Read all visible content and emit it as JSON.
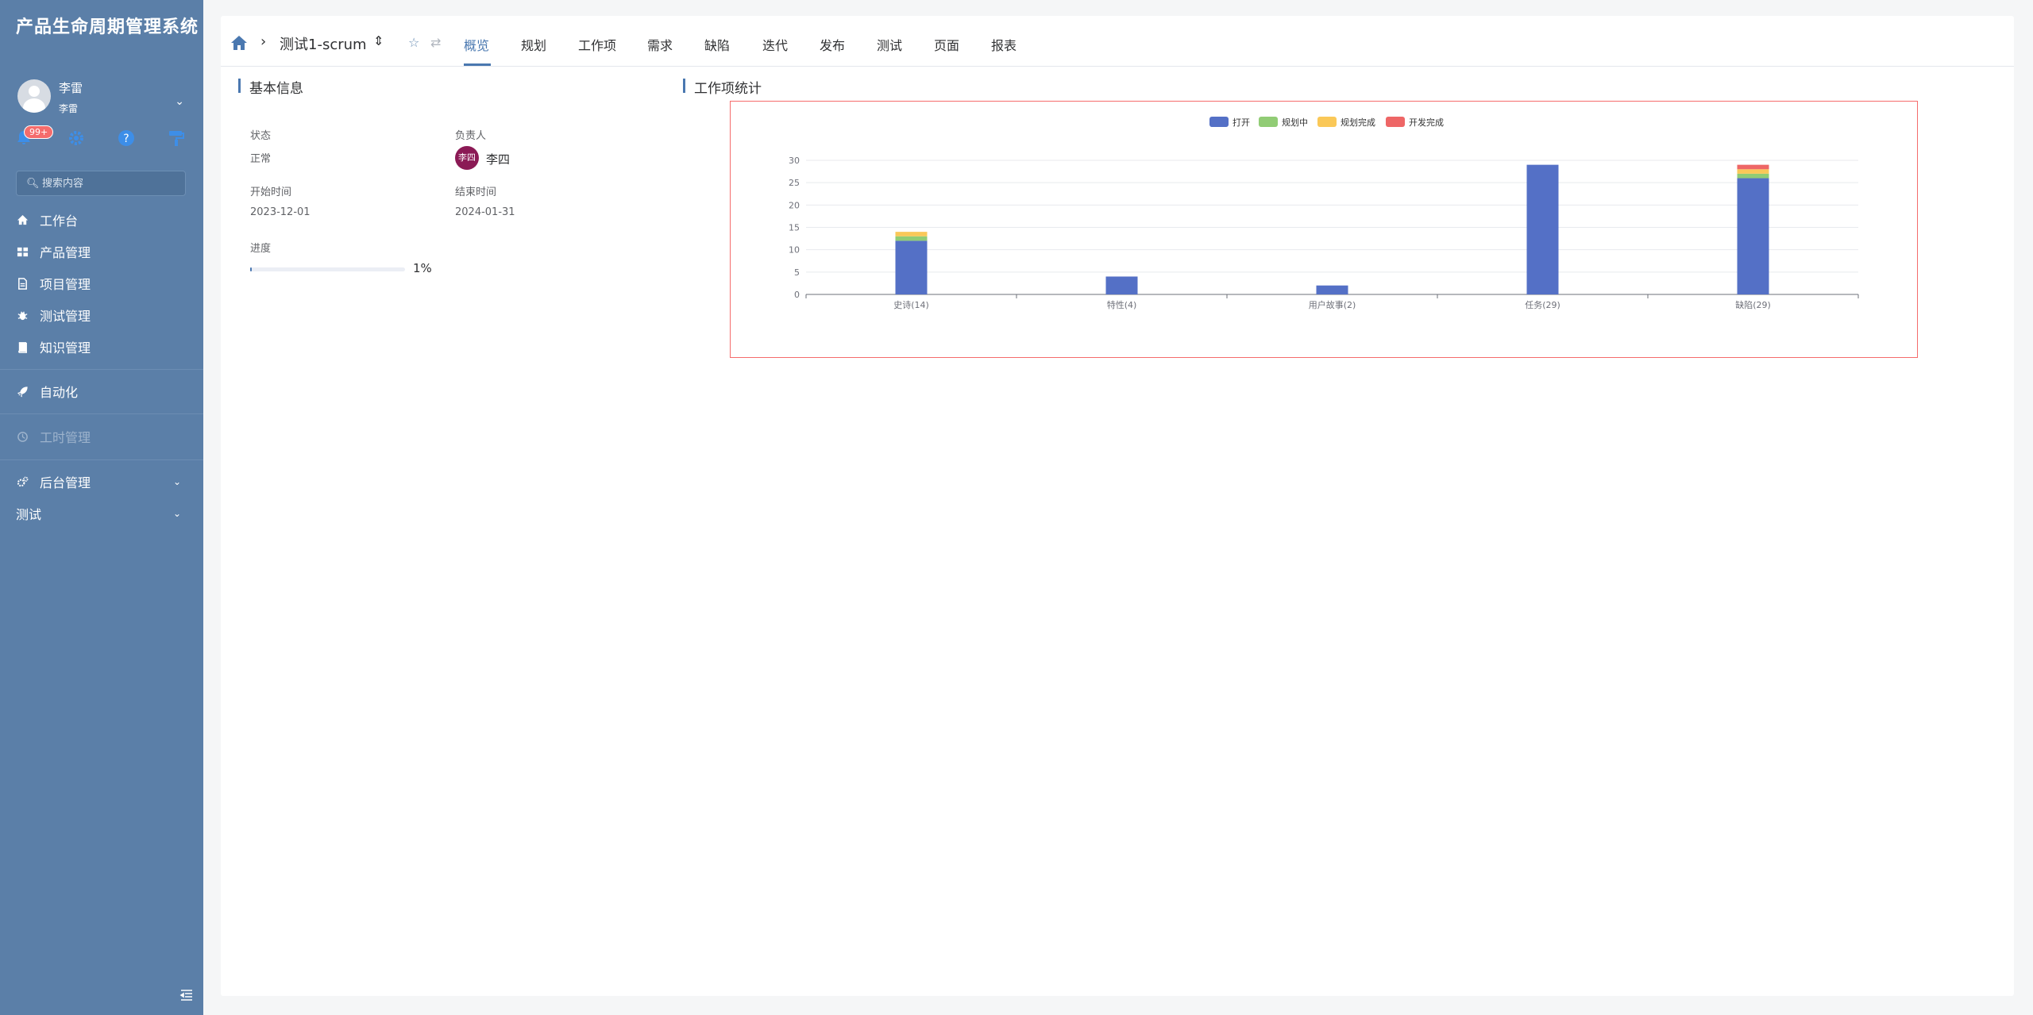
{
  "app": {
    "title": "产品生命周期管理系统"
  },
  "user": {
    "name": "李雷",
    "sub": "李雷"
  },
  "tools": {
    "notifications_badge": "99+"
  },
  "search": {
    "placeholder": "搜索内容"
  },
  "menu": [
    {
      "label": "工作台",
      "icon": "home-icon"
    },
    {
      "label": "产品管理",
      "icon": "grid-icon"
    },
    {
      "label": "项目管理",
      "icon": "document-icon"
    },
    {
      "label": "测试管理",
      "icon": "bug-icon"
    },
    {
      "label": "知识管理",
      "icon": "book-icon"
    },
    {
      "label": "自动化",
      "icon": "rocket-icon"
    },
    {
      "label": "工时管理",
      "icon": "clock-icon"
    },
    {
      "label": "后台管理",
      "icon": "gears-icon"
    },
    {
      "label": "测试",
      "icon": ""
    }
  ],
  "topbar": {
    "project": "测试1-scrum",
    "tabs": [
      "概览",
      "规划",
      "工作项",
      "需求",
      "缺陷",
      "迭代",
      "发布",
      "测试",
      "页面",
      "报表"
    ],
    "active_tab": 0
  },
  "basic_info": {
    "title": "基本信息",
    "status_label": "状态",
    "status_value": "正常",
    "owner_label": "负责人",
    "owner_avatar": "李四",
    "owner_name": "李四",
    "start_label": "开始时间",
    "start_value": "2023-12-01",
    "end_label": "结束时间",
    "end_value": "2024-01-31",
    "progress_label": "进度",
    "progress_text": "1%",
    "progress": 0.01
  },
  "workitem_stats": {
    "title": "工作项统计"
  },
  "chart_data": {
    "type": "bar",
    "stacked": true,
    "categories": [
      "史诗(14)",
      "特性(4)",
      "用户故事(2)",
      "任务(29)",
      "缺陷(29)"
    ],
    "series": [
      {
        "name": "打开",
        "color": "#5470c6",
        "values": [
          12,
          4,
          2,
          29,
          26
        ]
      },
      {
        "name": "规划中",
        "color": "#91cc75",
        "values": [
          1,
          0,
          0,
          0,
          1
        ]
      },
      {
        "name": "规划完成",
        "color": "#fac858",
        "values": [
          1,
          0,
          0,
          0,
          1
        ]
      },
      {
        "name": "开发完成",
        "color": "#ee6666",
        "values": [
          0,
          0,
          0,
          0,
          1
        ]
      }
    ],
    "ylim": [
      0,
      30
    ],
    "yticks": [
      0,
      5,
      10,
      15,
      20,
      25,
      30
    ],
    "legend": "top-center",
    "grid": true
  }
}
